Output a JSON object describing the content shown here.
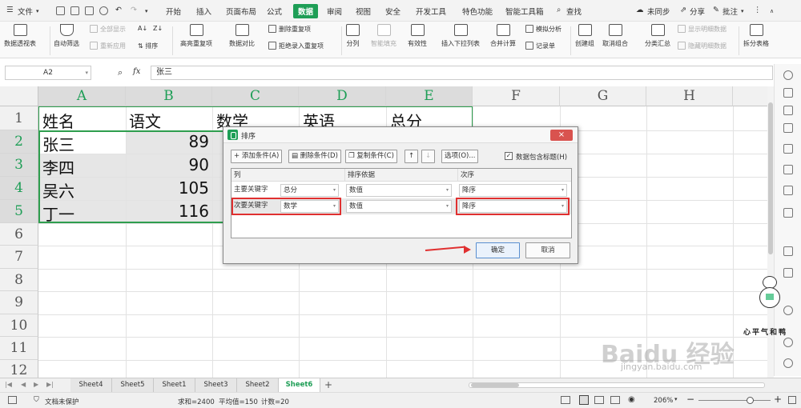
{
  "menu": {
    "file_label": "文件",
    "tabs": [
      "开始",
      "插入",
      "页面布局",
      "公式",
      "数据",
      "审阅",
      "视图",
      "安全",
      "开发工具",
      "特色功能",
      "智能工具箱"
    ],
    "active_tab": "数据",
    "search_label": "查找",
    "sync_label": "未同步",
    "share_label": "分享",
    "comment_label": "批注"
  },
  "ribbon": {
    "pivot": "数据透视表",
    "autofilter": "自动筛选",
    "showall": "全部显示",
    "reapply": "重新应用",
    "sort": "排序",
    "highlight_dup": "高亮重复项",
    "data_compare": "数据对比",
    "remove_dup": "删除重复项",
    "reject_dup": "拒绝录入重复项",
    "split_col": "分列",
    "smart_fill": "智能填充",
    "validity": "有效性",
    "insert_dropdown": "插入下拉列表",
    "merge_calc": "合并计算",
    "simulate": "模拟分析",
    "record": "记录单",
    "create_group": "创建组",
    "ungroup": "取消组合",
    "subtotal": "分类汇总",
    "show_detail": "显示明细数据",
    "hide_detail": "隐藏明细数据",
    "split_table": "拆分表格"
  },
  "formula_bar": {
    "cell_ref": "A2",
    "fx": "fx",
    "content": "张三"
  },
  "columns": [
    "A",
    "B",
    "C",
    "D",
    "E",
    "F",
    "G",
    "H"
  ],
  "rows": [
    "1",
    "2",
    "3",
    "4",
    "5",
    "6",
    "7",
    "8",
    "9",
    "10",
    "11",
    "12"
  ],
  "cells": {
    "header": [
      "姓名",
      "语文",
      "数学",
      "英语",
      "总分"
    ],
    "names": [
      "张三",
      "李四",
      "吴六",
      "丁一"
    ],
    "chinese": [
      "89",
      "90",
      "105",
      "116"
    ]
  },
  "sort_dialog": {
    "title": "排序",
    "close": "×",
    "add_condition": "添加条件(A)",
    "delete_condition": "删除条件(D)",
    "copy_condition": "复制条件(C)",
    "options": "选项(O)...",
    "header_checkbox": "数据包含标题(H)",
    "col_header": "列",
    "basis_header": "排序依据",
    "order_header": "次序",
    "rows": [
      {
        "label": "主要关键字",
        "column": "总分",
        "basis": "数值",
        "order": "降序"
      },
      {
        "label": "次要关键字",
        "column": "数学",
        "basis": "数值",
        "order": "降序"
      }
    ],
    "ok": "确定",
    "cancel": "取消"
  },
  "sheet_tabs": [
    "Sheet4",
    "Sheet5",
    "Sheet1",
    "Sheet3",
    "Sheet2",
    "Sheet6"
  ],
  "active_sheet": "Sheet6",
  "status": {
    "protect": "文档未保护",
    "sum": "求和=2400",
    "avg": "平均值=150",
    "count": "计数=20",
    "zoom": "206%"
  },
  "watermark": {
    "brand": "Baidu 经验",
    "url": "jingyan.baidu.com",
    "slogan": "心平气和鸭"
  },
  "colors": {
    "accent": "#1e9e56",
    "highlight_red": "#e03030"
  }
}
